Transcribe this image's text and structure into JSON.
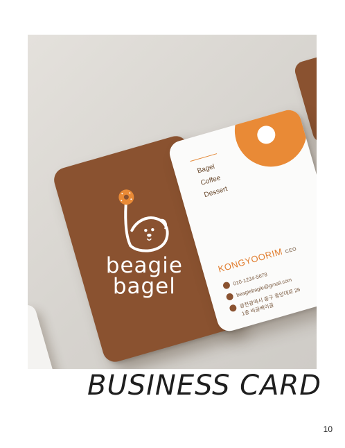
{
  "brown_card": {
    "logo_line1": "beagie",
    "logo_line2": "bagel"
  },
  "white_card": {
    "menu": [
      "Bagel",
      "Coffee",
      "Dessert"
    ],
    "name": "KONGYOORIM",
    "role": "CEO",
    "phone": "010-1234-5678",
    "email": "beagiebagle@gmail.com",
    "address_line1": "광전광역시 중구 중앙대로 26",
    "address_line2": "1층 비글베이글"
  },
  "page": {
    "title": "BUSINESS CARD",
    "number": "10"
  },
  "colors": {
    "brown": "#8a5230",
    "orange": "#e98a36",
    "background": "#d9d6d1"
  }
}
